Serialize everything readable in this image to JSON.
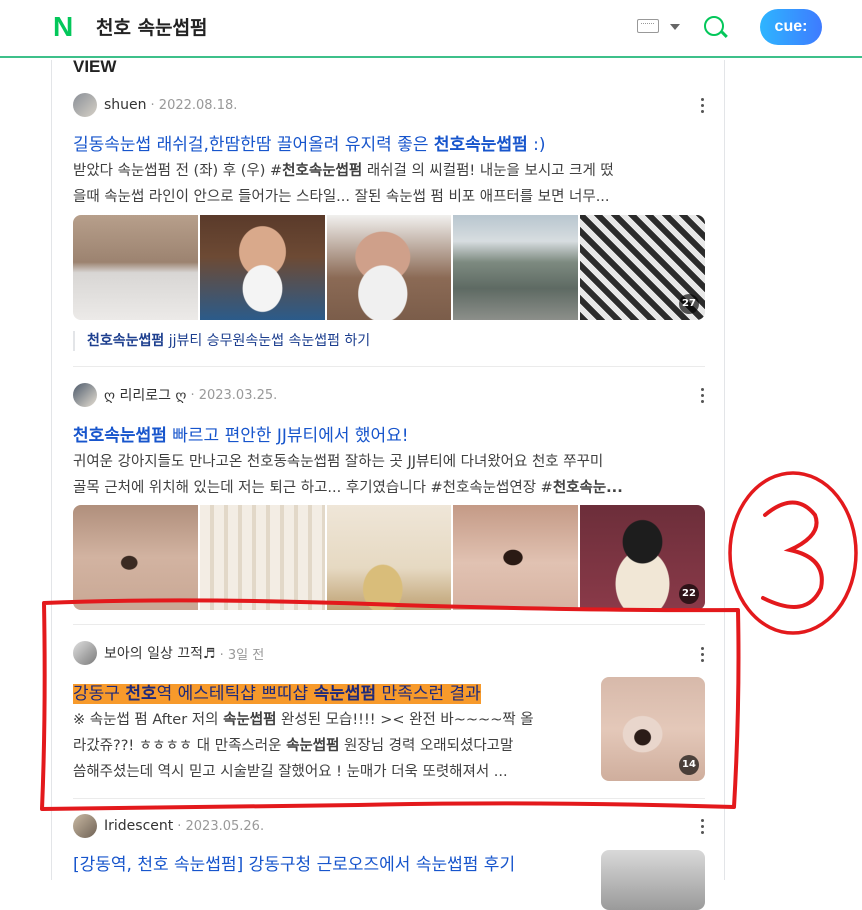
{
  "header": {
    "logo": "N",
    "query": "천호 속눈썹펌",
    "cue_label": "cue:"
  },
  "section_title": "VIEW",
  "posts": [
    {
      "author": "shuen",
      "date": "2022.08.18.",
      "title_pre": "길동속눈썹 래쉬걸,한땀한땀 끌어올려 유지력 좋은 ",
      "title_bold": "천호속눈썹펌",
      "title_post": " :)",
      "desc_line1_pre": "받았다 속눈썹펌 전 (좌) 후 (우) #",
      "desc_line1_bold": "천호속눈썹펌",
      "desc_line1_post": " 래쉬걸 의 씨컬펌! 내눈을 보시고 크게 떴",
      "desc_line2": "을때 속눈썹 라인이 안으로 들어가는 스타일... 잘된 속눈썹 펌 비포 애프터를 보면 너무...",
      "image_count": "27",
      "related_bold": "천호속눈썹펌",
      "related_rest": " jj뷰티 승무원속눈썹 속눈썹펌 하기"
    },
    {
      "author": "ღ 리리로그 ღ",
      "date": "2023.03.25.",
      "title_bold": "천호속눈썹펌",
      "title_post": " 빠르고 편안한 JJ뷰티에서 했어요!",
      "desc_line1": "귀여운 강아지들도 만나고온 천호동속눈썹펌 잘하는 곳 JJ뷰티에 다녀왔어요 천호 쭈꾸미",
      "desc_line2_pre": "골목 근처에 위치해 있는데 저는 퇴근 하고... 후기였습니다 #천호속눈썹연장 #",
      "desc_line2_bold": "천호속눈...",
      "image_count": "22"
    },
    {
      "author": "보아의 일상 끄적♬",
      "date": "3일 전",
      "title_a": "강동구 ",
      "title_b": "천호",
      "title_c": "역 에스테틱샵 쁘띠샵 ",
      "title_d": "속눈썹펌",
      "title_e": " 만족스런 결과",
      "desc_line1_pre": "※ 속눈썹 펌 After 저의 ",
      "desc_line1_bold": "속눈썹펌",
      "desc_line1_post": " 완성된 모습!!!! >< 완전 바~~~~짝 올",
      "desc_line2_pre": "라갔쥬??! ㅎㅎㅎㅎ 대 만족스러운 ",
      "desc_line2_bold": "속눈썹펌",
      "desc_line2_post": " 원장님 경력 오래되셨다고말",
      "desc_line3": "씀해주셨는데 역시 믿고 시술받길 잘했어요 ! 눈매가 더욱 또렷해져서 ...",
      "image_count": "14"
    },
    {
      "author": "Iridescent",
      "date": "2023.05.26.",
      "title_partial": "[강동역, 천호 속눈썹펌] 강동구청 근로오즈에서 속눈썹펌 후기"
    }
  ],
  "annotation": {
    "number": "3",
    "color": "#e3191c"
  }
}
